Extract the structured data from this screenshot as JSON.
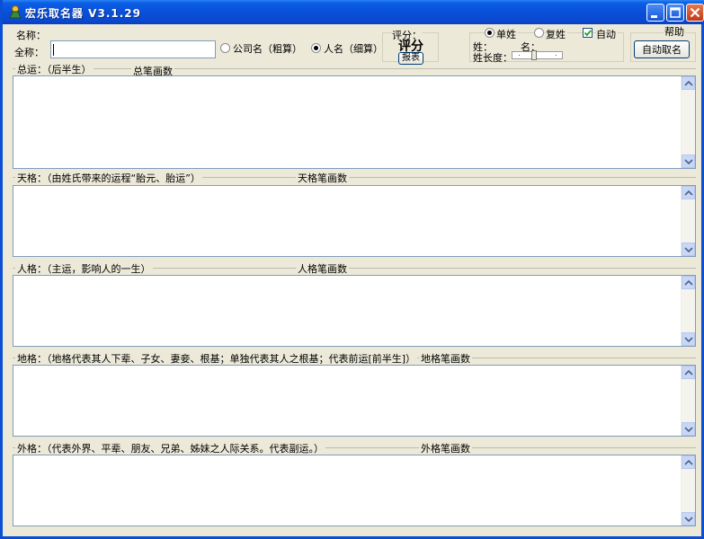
{
  "window": {
    "title": "宏乐取名器 V3.1.29"
  },
  "top": {
    "name_label": "名称：",
    "fullname_label": "全称：",
    "fullname_value": "",
    "type_company": "公司名（粗算）",
    "type_person": "人名（细算）",
    "score_label": "评分：",
    "score_title": "评分",
    "report_button": "报表",
    "single_surname": "单姓",
    "double_surname": "复姓",
    "auto_label": "自动",
    "help_label": "帮助",
    "surname_label": "姓：",
    "given_label": "名：",
    "surname_length_label": "姓长度：",
    "auto_name_button": "自动取名"
  },
  "state": {
    "selected_type": "人名（细算）",
    "selected_surname": "单姓",
    "auto_checked": true
  },
  "sections": [
    {
      "title": "总运：（后半生）",
      "stroke_label": "总笔画数",
      "content": ""
    },
    {
      "title": "天格：（由姓氏带来的运程“胎元、胎运”）",
      "stroke_label": "天格笔画数",
      "content": ""
    },
    {
      "title": "人格：（主运，影响人的一生）",
      "stroke_label": "人格笔画数",
      "content": ""
    },
    {
      "title": "地格：（地格代表其人下辈、子女、妻妾、根基；单独代表其人之根基；代表前运[前半生]）",
      "stroke_label": "地格笔画数",
      "content": ""
    },
    {
      "title": "外格：（代表外界、平辈、朋友、兄弟、姊妹之人际关系。代表副运。）",
      "stroke_label": "外格笔画数",
      "content": ""
    }
  ]
}
